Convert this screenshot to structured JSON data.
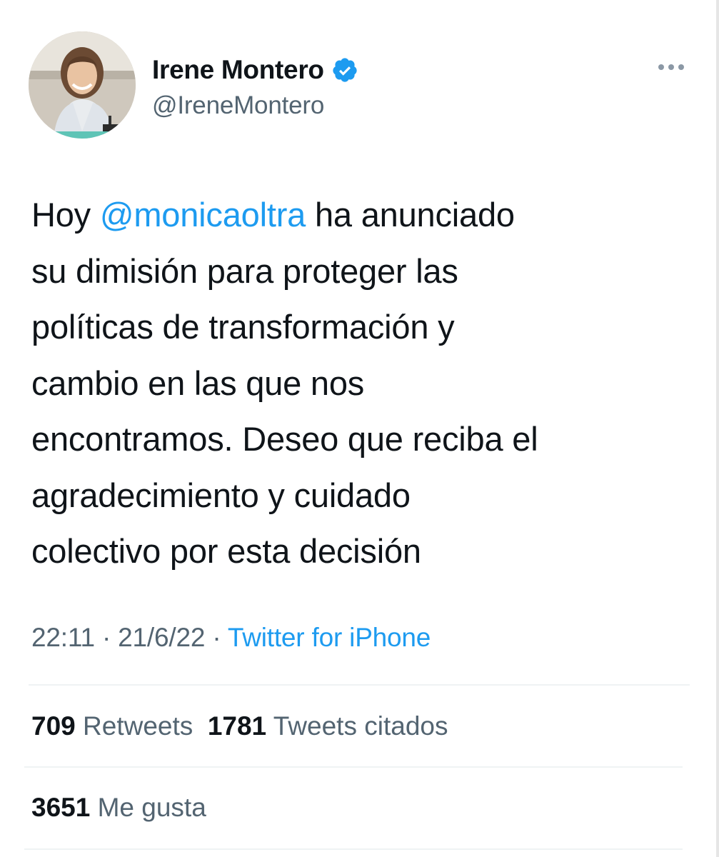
{
  "author": {
    "display_name": "Irene Montero",
    "handle": "@IreneMontero",
    "verified": true,
    "avatar_icon": "profile-photo",
    "verified_icon": "verified-badge-icon",
    "more_icon": "more-options-icon"
  },
  "tweet": {
    "text_parts": [
      {
        "type": "text",
        "value": "Hoy "
      },
      {
        "type": "mention",
        "value": "@monicaoltra"
      },
      {
        "type": "text",
        "value": " ha anunciado\nsu dimisión para proteger las\npolíticas de transformación y\ncambio en las que nos\nencontramos. Deseo que reciba el\nagradecimiento y cuidado\ncolectivo por esta decisión"
      }
    ],
    "time": "22:11",
    "separator": "·",
    "date": "21/6/22",
    "source": "Twitter for iPhone"
  },
  "stats": {
    "retweets_count": "709",
    "retweets_label": "Retweets",
    "quotes_count": "1781",
    "quotes_label": "Tweets citados",
    "likes_count": "3651",
    "likes_label": "Me gusta"
  },
  "colors": {
    "accent": "#1d9bf0",
    "text": "#0f1419",
    "secondary": "#536471",
    "divider": "#eff3f4"
  }
}
